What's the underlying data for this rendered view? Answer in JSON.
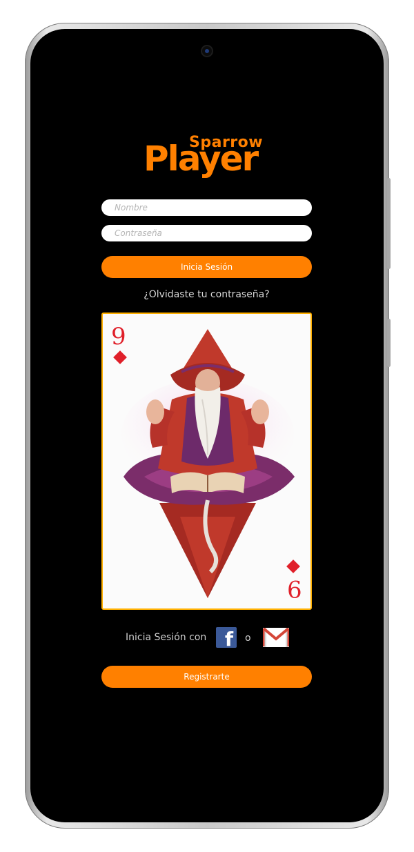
{
  "app": {
    "logo_top": "Sparrow",
    "logo_main": "Player",
    "accent": "#ff8000"
  },
  "login": {
    "username_placeholder": "Nombre",
    "password_placeholder": "Contraseña",
    "login_button": "Inicia Sesión",
    "forgot_link": "¿Olvidaste tu contraseña?"
  },
  "card": {
    "rank": "9",
    "suit": "diamond-icon",
    "suit_color": "#e0202a"
  },
  "social": {
    "prefix": "Inicia Sesión con",
    "facebook_icon": "facebook-icon",
    "facebook_letter": "f",
    "or_text": "o",
    "gmail_icon": "gmail-icon"
  },
  "register": {
    "button": "Registrarte"
  }
}
